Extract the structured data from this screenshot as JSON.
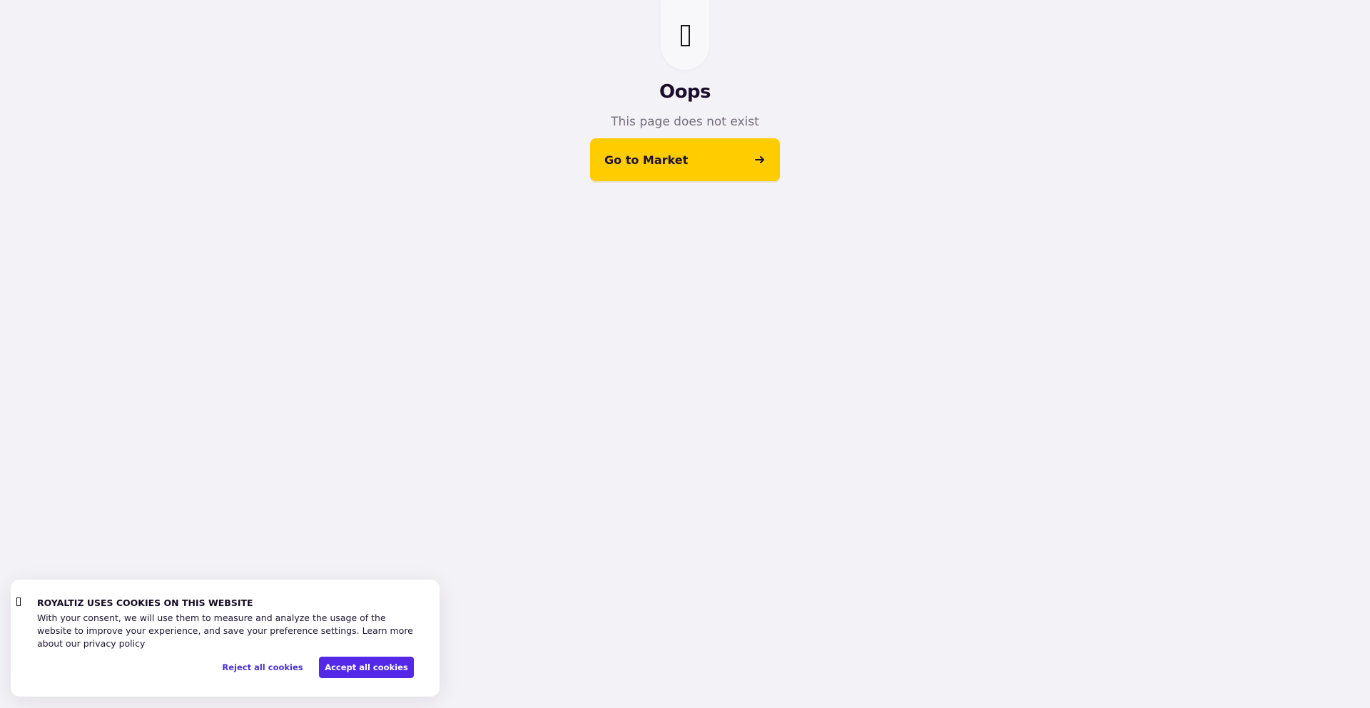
{
  "error_page": {
    "icon": "missing-glyph-icon",
    "title": "Oops",
    "subtitle": "This page does not exist",
    "primary_button": {
      "label": "Go to Market",
      "icon": "arrow-right-icon"
    }
  },
  "cookie_banner": {
    "icon": "missing-glyph-icon",
    "title": "ROYALTIZ USES COOKIES ON THIS WEBSITE",
    "message": "With your consent, we will use them to measure and analyze the usage of the website to improve your experience, and save your preference settings. Learn more about our privacy policy",
    "reject_label": "Reject all cookies",
    "accept_label": "Accept all cookies"
  },
  "colors": {
    "background": "#f3f2f6",
    "primary_yellow": "#ffcc00",
    "cookie_accent": "#5328e7"
  }
}
